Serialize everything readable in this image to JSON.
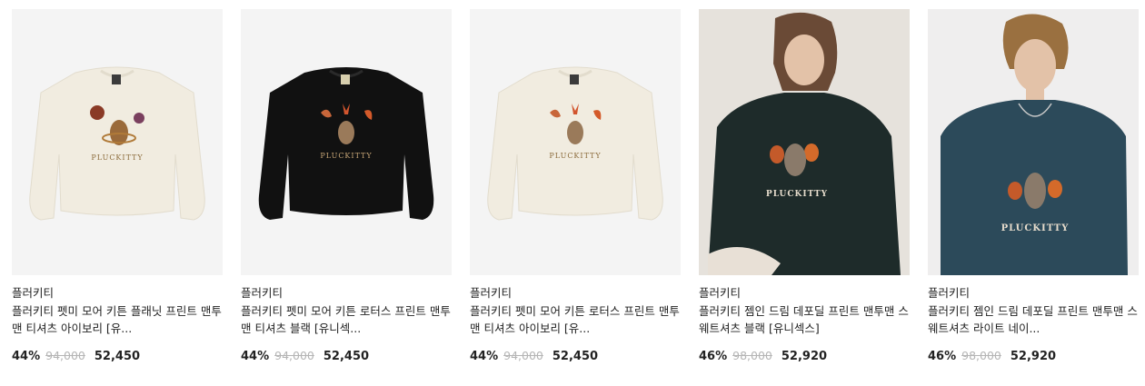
{
  "products": [
    {
      "brand": "플러키티",
      "title": "플러키티 펫미 모어 키튼 플래닛 프린트 맨투맨 티셔츠 아이보리 [유...",
      "discount": "44%",
      "original_price": "94,000",
      "sale_price": "52,450",
      "garment_color": "#f1ece0",
      "print_text": "PLUCKITTY"
    },
    {
      "brand": "플러키티",
      "title": "플러키티 펫미 모어 키튼 로터스 프린트 맨투맨 티셔츠 블랙 [유니섹...",
      "discount": "44%",
      "original_price": "94,000",
      "sale_price": "52,450",
      "garment_color": "#111111",
      "print_text": "PLUCKITTY"
    },
    {
      "brand": "플러키티",
      "title": "플러키티 펫미 모어 키튼 로터스 프린트 맨투맨 티셔츠 아이보리 [유...",
      "discount": "44%",
      "original_price": "94,000",
      "sale_price": "52,450",
      "garment_color": "#f1ece0",
      "print_text": "PLUCKITTY"
    },
    {
      "brand": "플러키티",
      "title": "플러키티 젬인 드림 데포딜 프린트 맨투맨 스웨트셔츠 블랙 [유니섹스]",
      "discount": "46%",
      "original_price": "98,000",
      "sale_price": "52,920",
      "garment_color": "#1e2b2a",
      "print_text": "PLUCKITTY"
    },
    {
      "brand": "플러키티",
      "title": "플러키티 젬인 드림 데포딜 프린트 맨투맨 스웨트셔츠 라이트 네이...",
      "discount": "46%",
      "original_price": "98,000",
      "sale_price": "52,920",
      "garment_color": "#2c4a5a",
      "print_text": "PLUCKITTY"
    }
  ]
}
